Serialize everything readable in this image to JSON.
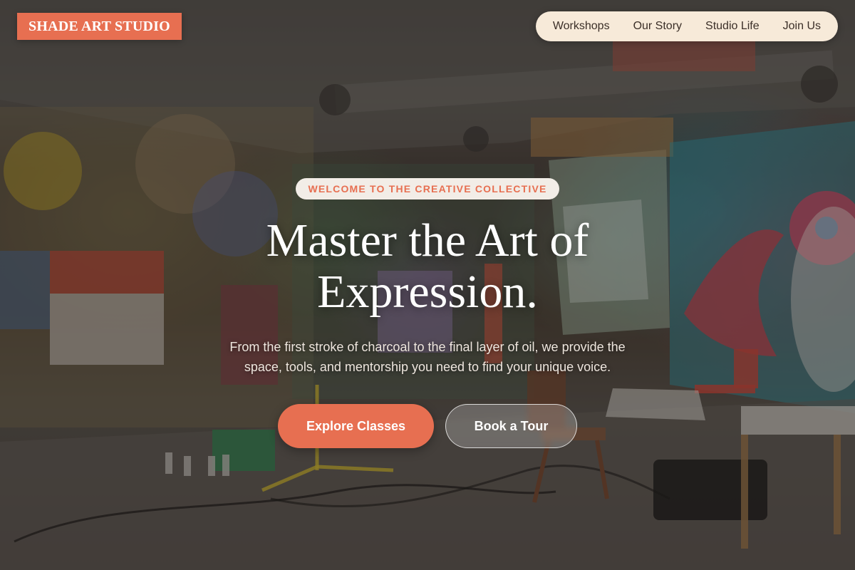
{
  "header": {
    "logo": "SHADE ART STUDIO",
    "nav": [
      {
        "label": "Workshops"
      },
      {
        "label": "Our Story"
      },
      {
        "label": "Studio Life"
      },
      {
        "label": "Join Us"
      }
    ]
  },
  "hero": {
    "eyebrow": "WELCOME TO THE CREATIVE COLLECTIVE",
    "headline_line1": "Master the Art of",
    "headline_line2": "Expression.",
    "subtext_line1": "From the first stroke of charcoal to the final layer of oil, we provide the",
    "subtext_line2": "space, tools, and mentorship you need to find your unique voice.",
    "primary_button": "Explore Classes",
    "secondary_button": "Book a Tour",
    "background_image": "graffiti-art-studio-photo"
  },
  "colors": {
    "accent": "#e76f51",
    "nav_background": "#f7ead9",
    "eyebrow_background": "#f2ede7",
    "text_light": "#ffffff"
  }
}
